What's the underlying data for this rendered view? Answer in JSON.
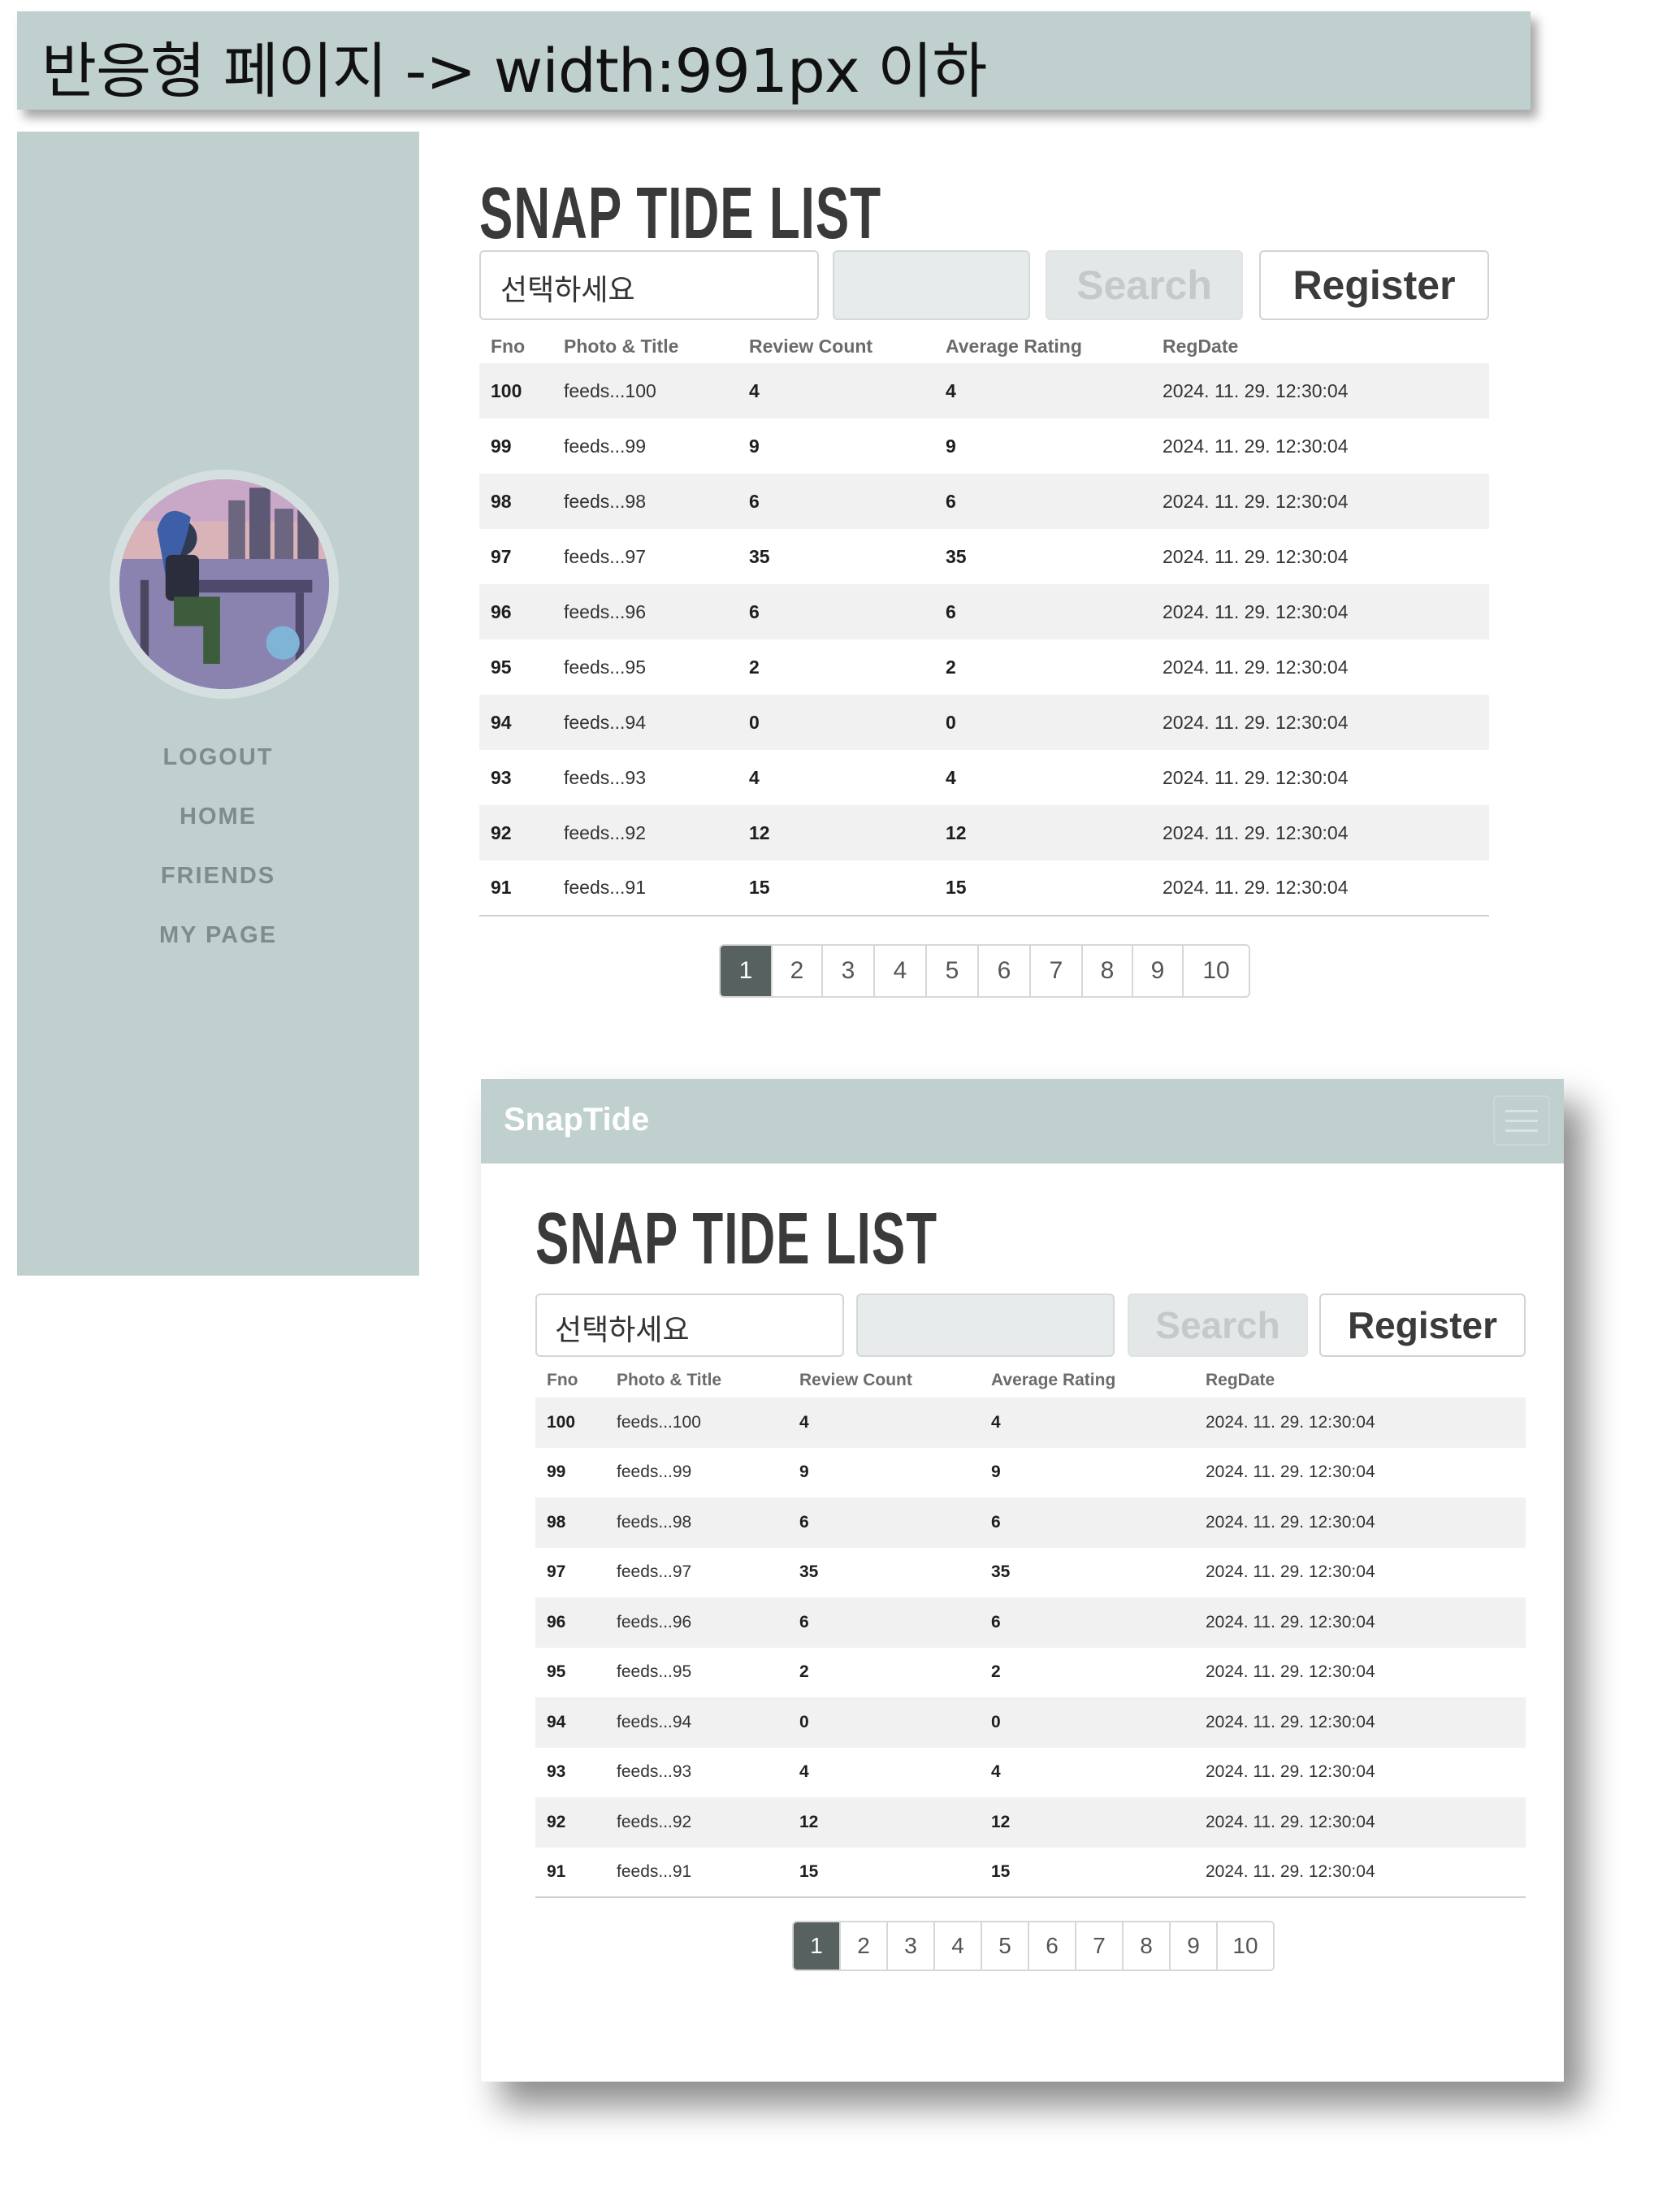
{
  "banner": {
    "text": "반응형 페이지 -> width:991px 이하"
  },
  "sidebar": {
    "avatar_icon": "profile-illustration",
    "nav": [
      "LOGOUT",
      "HOME",
      "FRIENDS",
      "MY PAGE"
    ]
  },
  "list": {
    "title": "SNAP TIDE  LIST",
    "select_value": "선택하세요",
    "search_label": "Search",
    "register_label": "Register",
    "columns": [
      "Fno",
      "Photo & Title",
      "Review Count",
      "Average Rating",
      "RegDate"
    ],
    "rows": [
      [
        "100",
        "feeds...100",
        "4",
        "4",
        "2024. 11. 29. 12:30:04"
      ],
      [
        "99",
        "feeds...99",
        "9",
        "9",
        "2024. 11. 29. 12:30:04"
      ],
      [
        "98",
        "feeds...98",
        "6",
        "6",
        "2024. 11. 29. 12:30:04"
      ],
      [
        "97",
        "feeds...97",
        "35",
        "35",
        "2024. 11. 29. 12:30:04"
      ],
      [
        "96",
        "feeds...96",
        "6",
        "6",
        "2024. 11. 29. 12:30:04"
      ],
      [
        "95",
        "feeds...95",
        "2",
        "2",
        "2024. 11. 29. 12:30:04"
      ],
      [
        "94",
        "feeds...94",
        "0",
        "0",
        "2024. 11. 29. 12:30:04"
      ],
      [
        "93",
        "feeds...93",
        "4",
        "4",
        "2024. 11. 29. 12:30:04"
      ],
      [
        "92",
        "feeds...92",
        "12",
        "12",
        "2024. 11. 29. 12:30:04"
      ],
      [
        "91",
        "feeds...91",
        "15",
        "15",
        "2024. 11. 29. 12:30:04"
      ]
    ],
    "pages": [
      "1",
      "2",
      "3",
      "4",
      "5",
      "6",
      "7",
      "8",
      "9",
      "10"
    ],
    "active_page": "1"
  },
  "mobile": {
    "brand": "SnapTide",
    "toggler_icon": "hamburger-menu-icon"
  },
  "colors": {
    "sage": "#bfd0cf",
    "pager_active": "#566160",
    "nav_text": "#7d8d8b"
  }
}
